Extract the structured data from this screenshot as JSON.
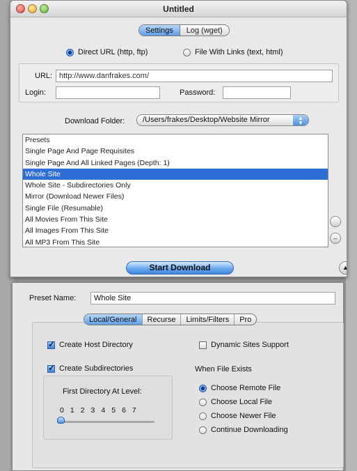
{
  "window": {
    "title": "Untitled",
    "tabs": [
      "Settings",
      "Log (wget)"
    ]
  },
  "source": {
    "option_direct": "Direct URL (http, ftp)",
    "option_file": "File With Links (text, html)",
    "selected": "Direct URL (http, ftp)"
  },
  "url_panel": {
    "url_label": "URL:",
    "url_value": "http://www.danfrakes.com/",
    "login_label": "Login:",
    "login_value": "",
    "password_label": "Password:",
    "password_value": ""
  },
  "download_folder": {
    "label": "Download Folder:",
    "value": "/Users/frakes/Desktop/Website Mirror"
  },
  "presets": {
    "items": [
      "Presets",
      "Single Page And Page Requisites",
      "Single Page And All Linked Pages (Depth: 1)",
      "Whole Site",
      "Whole Site - Subdirectories Only",
      "Mirror (Download Newer Files)",
      "Single File (Resumable)",
      "All Movies From This Site",
      "All Images From This Site",
      "All MP3 From This Site"
    ],
    "selected": "Whole Site"
  },
  "actions": {
    "start_download": "Start Download"
  },
  "drawer": {
    "preset_name_label": "Preset Name:",
    "preset_name_value": "Whole Site",
    "tabs": [
      "Local/General",
      "Recurse",
      "Limits/Filters",
      "Pro"
    ],
    "active_tab": "Local/General",
    "create_host_directory": "Create Host Directory",
    "create_subdirectories": "Create Subdirectories",
    "dynamic_sites_support": "Dynamic Sites Support",
    "first_directory_label": "First Directory At Level:",
    "levels": [
      "0",
      "1",
      "2",
      "3",
      "4",
      "5",
      "6",
      "7"
    ],
    "level_value": 0,
    "when_file_exists_label": "When File Exists",
    "file_exists_options": [
      "Choose Remote File",
      "Choose Local File",
      "Choose Newer File",
      "Continue Downloading"
    ],
    "file_exists_selected": "Choose Remote File"
  }
}
